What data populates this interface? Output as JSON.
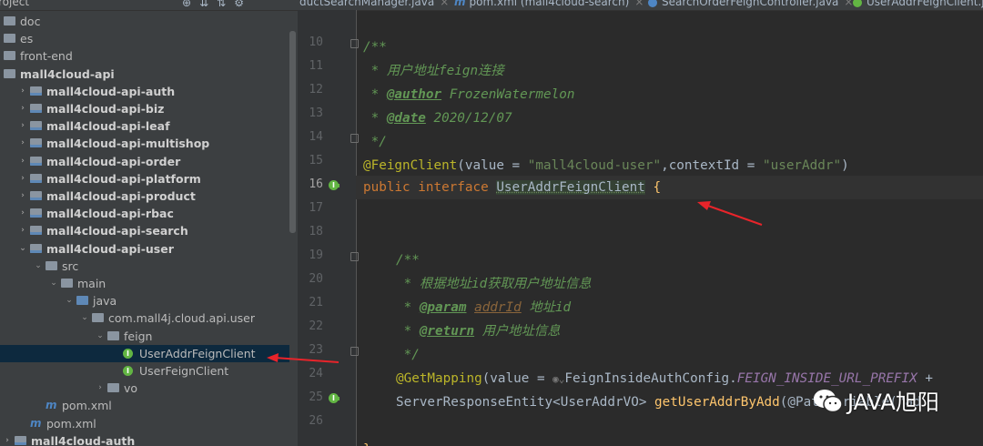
{
  "project_panel": {
    "title": "roject",
    "toolbar_icons": [
      "target-icon",
      "collapse-all-icon",
      "expand-all-icon",
      "gear-icon"
    ],
    "items": [
      {
        "label": "doc",
        "level": 0,
        "arrow": "",
        "icon": "folder",
        "bold": false,
        "selected": false
      },
      {
        "label": "es",
        "level": 0,
        "arrow": "",
        "icon": "folder",
        "bold": false,
        "selected": false
      },
      {
        "label": "front-end",
        "level": 0,
        "arrow": "",
        "icon": "folder",
        "bold": false,
        "selected": false
      },
      {
        "label": "mall4cloud-api",
        "level": 0,
        "arrow": "",
        "icon": "folder",
        "bold": true,
        "selected": false
      },
      {
        "label": "mall4cloud-api-auth",
        "level": 1,
        "arrow": "›",
        "icon": "module",
        "bold": true,
        "selected": false
      },
      {
        "label": "mall4cloud-api-biz",
        "level": 1,
        "arrow": "›",
        "icon": "module",
        "bold": true,
        "selected": false
      },
      {
        "label": "mall4cloud-api-leaf",
        "level": 1,
        "arrow": "›",
        "icon": "module",
        "bold": true,
        "selected": false
      },
      {
        "label": "mall4cloud-api-multishop",
        "level": 1,
        "arrow": "›",
        "icon": "module",
        "bold": true,
        "selected": false
      },
      {
        "label": "mall4cloud-api-order",
        "level": 1,
        "arrow": "›",
        "icon": "module",
        "bold": true,
        "selected": false
      },
      {
        "label": "mall4cloud-api-platform",
        "level": 1,
        "arrow": "›",
        "icon": "module",
        "bold": true,
        "selected": false
      },
      {
        "label": "mall4cloud-api-product",
        "level": 1,
        "arrow": "›",
        "icon": "module",
        "bold": true,
        "selected": false
      },
      {
        "label": "mall4cloud-api-rbac",
        "level": 1,
        "arrow": "›",
        "icon": "module",
        "bold": true,
        "selected": false
      },
      {
        "label": "mall4cloud-api-search",
        "level": 1,
        "arrow": "›",
        "icon": "module",
        "bold": true,
        "selected": false
      },
      {
        "label": "mall4cloud-api-user",
        "level": 1,
        "arrow": "⌄",
        "icon": "module",
        "bold": true,
        "selected": false
      },
      {
        "label": "src",
        "level": 2,
        "arrow": "⌄",
        "icon": "folder",
        "bold": false,
        "selected": false
      },
      {
        "label": "main",
        "level": 3,
        "arrow": "⌄",
        "icon": "folder",
        "bold": false,
        "selected": false
      },
      {
        "label": "java",
        "level": 4,
        "arrow": "⌄",
        "icon": "src",
        "bold": false,
        "selected": false
      },
      {
        "label": "com.mall4j.cloud.api.user",
        "level": 5,
        "arrow": "⌄",
        "icon": "pkg",
        "bold": false,
        "selected": false
      },
      {
        "label": "feign",
        "level": 6,
        "arrow": "⌄",
        "icon": "pkg",
        "bold": false,
        "selected": false
      },
      {
        "label": "UserAddrFeignClient",
        "level": 7,
        "arrow": "",
        "icon": "iface",
        "bold": false,
        "selected": true
      },
      {
        "label": "UserFeignClient",
        "level": 7,
        "arrow": "",
        "icon": "iface",
        "bold": false,
        "selected": false
      },
      {
        "label": "vo",
        "level": 6,
        "arrow": "›",
        "icon": "pkg",
        "bold": false,
        "selected": false
      },
      {
        "label": "pom.xml",
        "level": 2,
        "arrow": "",
        "icon": "maven",
        "bold": false,
        "selected": false
      },
      {
        "label": "pom.xml",
        "level": 1,
        "arrow": "",
        "icon": "maven",
        "bold": false,
        "selected": false
      },
      {
        "label": "mall4cloud-auth",
        "level": 0,
        "arrow": "›",
        "icon": "module",
        "bold": true,
        "selected": false
      }
    ]
  },
  "editor_tabs": [
    {
      "label": "ductSearchManager.java",
      "icon": "",
      "active": false
    },
    {
      "label": "pom.xml (mall4cloud-search)",
      "icon": "maven",
      "active": false
    },
    {
      "label": "SearchOrderFeignController.java",
      "icon": "class",
      "active": false
    },
    {
      "label": "UserAddrFeignClient.j",
      "icon": "iface",
      "active": true
    }
  ],
  "gutter": {
    "line_numbers": [
      "10",
      "11",
      "12",
      "13",
      "14",
      "15",
      "16",
      "17",
      "18",
      "19",
      "20",
      "21",
      "22",
      "23",
      "24",
      "25",
      "26"
    ],
    "current_line": "16",
    "impl_marker_lines": [
      "16",
      "25"
    ],
    "fold_marker_lines": [
      "10",
      "14",
      "19",
      "23"
    ],
    "marker_glyph": "I"
  },
  "code": {
    "l10": "/**",
    "l11": " * 用户地址feign连接",
    "l12_tag": "@author",
    "l12_text": " FrozenWatermelon",
    "l13_tag": "@date",
    "l13_text": " 2020/12/07",
    "l14": " */",
    "l15_ann": "@FeignClient",
    "l15_p1": "(value = ",
    "l15_s1": "\"mall4cloud-user\"",
    "l15_p2": ",contextId = ",
    "l15_s2": "\"userAddr\"",
    "l15_p3": ")",
    "l16_kw": "public interface ",
    "l16_name": "UserAddrFeignClient",
    "l16_brace": " {",
    "l19": "/**",
    "l20": " * 根据地址id获取用户地址信息",
    "l21_tag": "@param",
    "l21_param": "addrId",
    "l21_text": " 地址id",
    "l22_tag": "@return",
    "l22_text": " 用户地址信息",
    "l23": " */",
    "l24_ann": "@GetMapping",
    "l24_p1": "(value = ",
    "l24_cls": "FeignInsideAuthConfig.",
    "l24_const": "FEIGN_INSIDE_URL_PREFIX",
    "l24_p2": " +",
    "l25_type": "ServerResponseEntity<UserAddrVO> ",
    "l25_fn": "getUserAddrByAdd",
    "l25_rest": "(@PathVariable(\"ad"
  },
  "watermark": {
    "text": "JAVA旭阳",
    "icon": "wechat-icon"
  },
  "colors": {
    "arrow": "#e8242a",
    "selection": "#0d293e",
    "comment": "#629755",
    "keyword": "#cc7832",
    "string": "#6a8759",
    "annotation": "#bbb529"
  }
}
